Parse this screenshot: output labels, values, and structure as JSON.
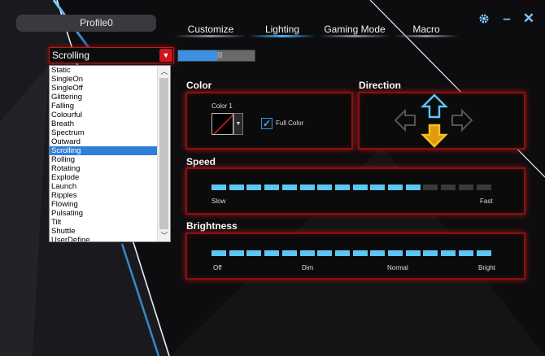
{
  "app": {
    "profile_name": "Profile0",
    "tabs": [
      {
        "label": "Customize",
        "active": false
      },
      {
        "label": "Lighting",
        "active": true
      },
      {
        "label": "Gaming Mode",
        "active": false
      },
      {
        "label": "Macro",
        "active": false
      }
    ],
    "window_buttons": {
      "settings": "settings-gear-icon",
      "minimize": "minimize-icon",
      "close": "close-icon"
    }
  },
  "effect_select": {
    "selected": "Scrolling",
    "toggle_on": true,
    "options": [
      "Static",
      "SingleOn",
      "SingleOff",
      "Glittering",
      "Falling",
      "Colourful",
      "Breath",
      "Spectrum",
      "Outward",
      "Scrolling",
      "Rolling",
      "Rotating",
      "Explode",
      "Launch",
      "Ripples",
      "Flowing",
      "Pulsating",
      "Tilt",
      "Shuttle",
      "UserDefine"
    ]
  },
  "color": {
    "title": "Color",
    "color1_label": "Color 1",
    "full_color_label": "Full Color",
    "full_color_checked": true
  },
  "direction": {
    "title": "Direction",
    "active": "down",
    "colors": {
      "up": "#5cc7f5",
      "down": "#f5b21a",
      "side": "#555555"
    }
  },
  "speed": {
    "title": "Speed",
    "level": 12,
    "max": 16,
    "labels": {
      "min": "Slow",
      "max": "Fast"
    }
  },
  "brightness": {
    "title": "Brightness",
    "level": 16,
    "max": 16,
    "labels": {
      "off": "Off",
      "dim": "Dim",
      "normal": "Normal",
      "bright": "Bright"
    }
  },
  "theme": {
    "accent_red": "#c01a1a",
    "accent_blue": "#5cc7f5"
  }
}
